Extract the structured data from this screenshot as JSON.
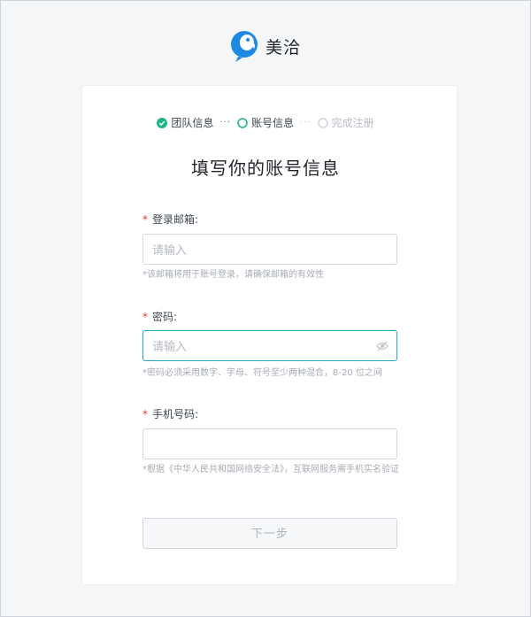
{
  "brand": {
    "name": "美洽",
    "logo_icon": "parrot-logo-icon",
    "color": "#1e88e5"
  },
  "steps": [
    {
      "label": "团队信息",
      "status": "done",
      "icon": "check-circle-icon"
    },
    {
      "separator": "···"
    },
    {
      "label": "账号信息",
      "status": "active",
      "icon": "ring-icon"
    },
    {
      "separator": "···"
    },
    {
      "label": "完成注册",
      "status": "todo",
      "icon": "ring-icon"
    }
  ],
  "page_title": "填写你的账号信息",
  "form": {
    "email": {
      "required_mark": "*",
      "label": "登录邮箱:",
      "placeholder": "请输入",
      "value": "",
      "hint": "*该邮箱将用于账号登录，请确保邮箱的有效性"
    },
    "password": {
      "required_mark": "*",
      "label": "密码:",
      "placeholder": "请输入",
      "value": "",
      "toggle_icon": "eye-off-icon",
      "hint": "*密码必须采用数字、字母、符号至少两种混合，8-20 位之间"
    },
    "phone": {
      "required_mark": "*",
      "label": "手机号码:",
      "placeholder": "",
      "value": "",
      "hint": "*根据《中华人民共和国网络安全法》，互联网服务需手机实名验证"
    },
    "next_label": "下一步"
  },
  "colors": {
    "accent": "#28a6c2",
    "success": "#1fb589",
    "required": "#e53935"
  }
}
